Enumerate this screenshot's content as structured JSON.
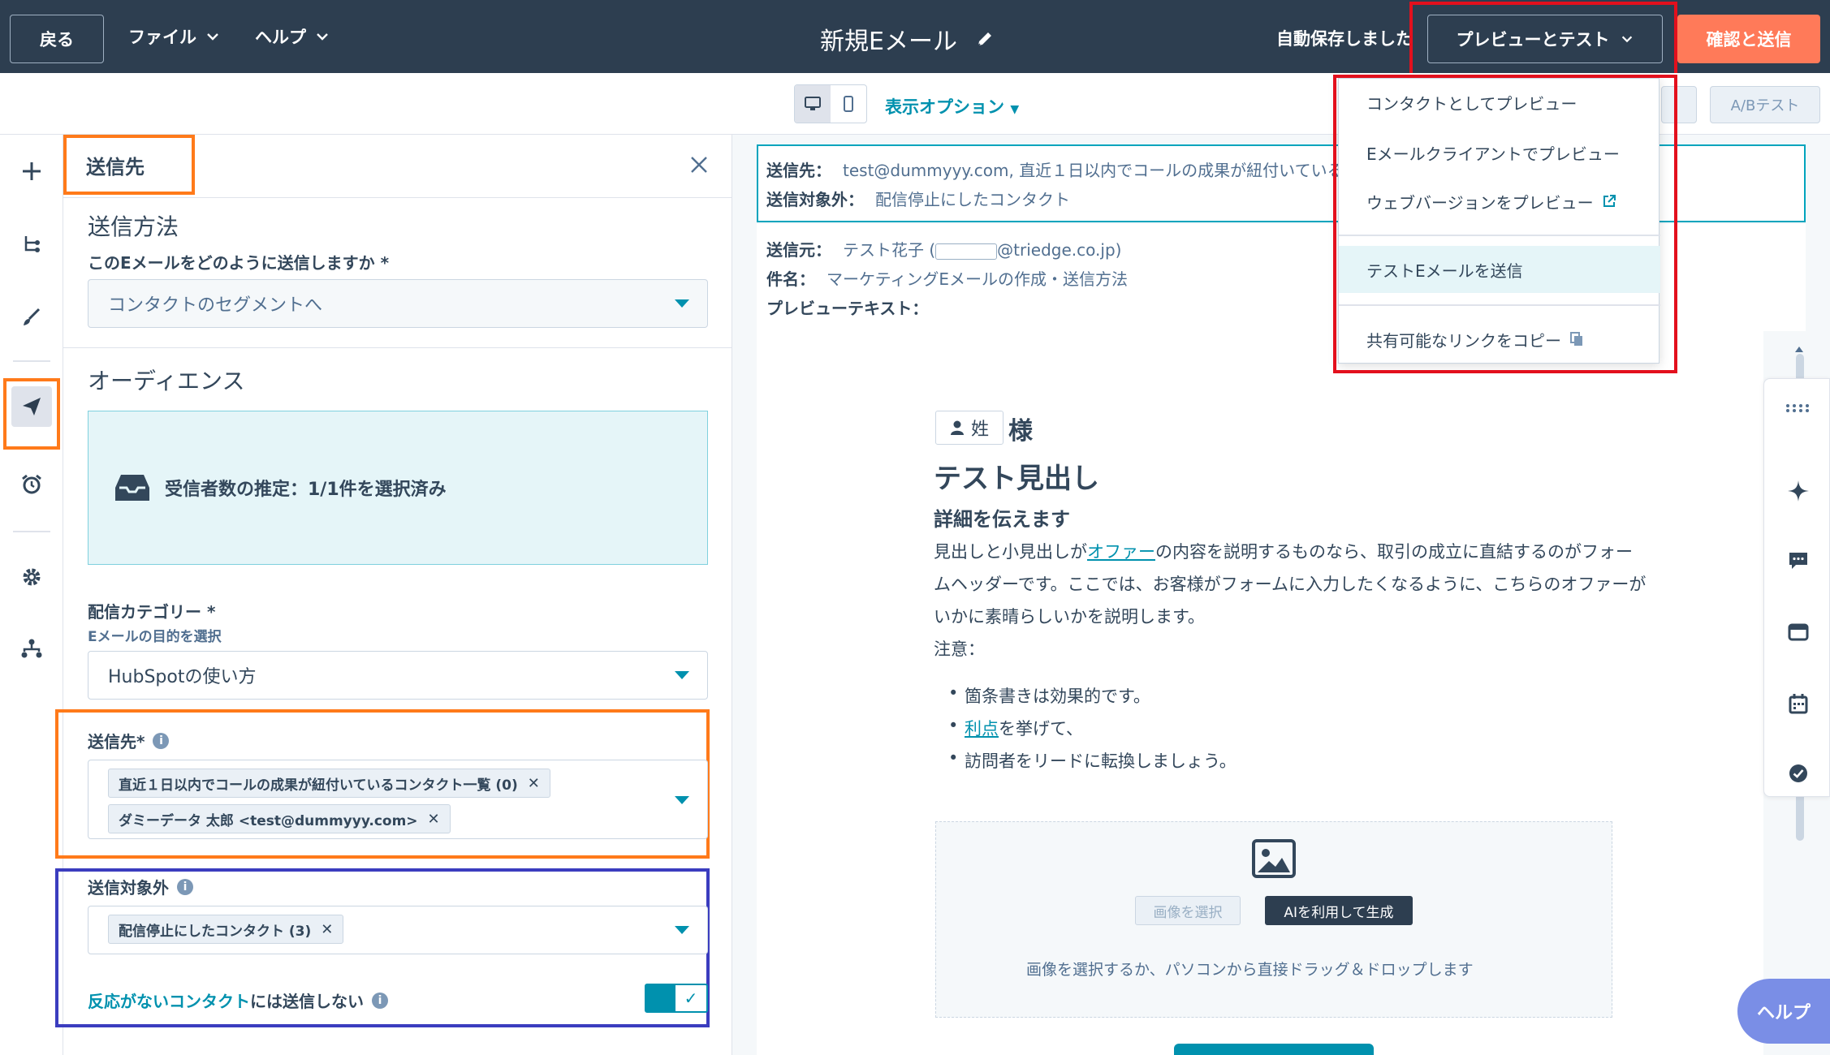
{
  "topbar": {
    "back_label": "戻る",
    "file_menu": "ファイル",
    "help_menu": "ヘルプ",
    "title": "新規Eメール",
    "autosave": "自動保存しました",
    "preview_test_label": "プレビューとテスト",
    "confirm_send_label": "確認と送信"
  },
  "subbar": {
    "display_options": "表示オプション",
    "ab_test": "A/Bテスト"
  },
  "rail": {
    "icons": [
      "plus-icon",
      "tree-icon",
      "brush-icon",
      "send-icon",
      "clock-icon",
      "gear-icon",
      "org-icon"
    ],
    "active": "send-icon"
  },
  "panel": {
    "title": "送信先",
    "send_method": {
      "heading": "送信方法",
      "label": "このEメールをどのように送信しますか *",
      "value": "コンタクトのセグメントへ"
    },
    "audience": {
      "heading": "オーディエンス",
      "estimate": "受信者数の推定：1/1件を選択済み"
    },
    "category": {
      "label": "配信カテゴリー *",
      "sublabel": "Eメールの目的を選択",
      "value": "HubSpotの使い方"
    },
    "send_to": {
      "label": "送信先*",
      "tags": [
        "直近１日以内でコールの成果が紐付いているコンタクト一覧 (0)",
        "ダミーデータ 太郎 <test@dummyyy.com>"
      ]
    },
    "exclude": {
      "label": "送信対象外",
      "tags": [
        "配信停止にしたコンタクト (3)"
      ]
    },
    "unengaged": {
      "link": "反応がないコンタクト",
      "rest": "には送信しない",
      "enabled": true
    }
  },
  "preview": {
    "to_label": "送信先：",
    "to_value": "test@dummyyy.com, 直近１日以内でコールの成果が紐付いている",
    "exclude_label": "送信対象外：",
    "exclude_value": "配信停止にしたコンタクト",
    "from_label": "送信元：",
    "from_value_pre": "テスト花子 (",
    "from_value_post": "@triedge.co.jp)",
    "subject_label": "件名：",
    "subject_value": "マーケティングEメールの作成・送信方法",
    "preview_text_label": "プレビューテキスト：",
    "token": "姓",
    "honorific": "様",
    "heading": "テスト見出し",
    "subheading": "詳細を伝えます",
    "para_1": "見出しと小見出しが",
    "para_link": "オファー",
    "para_2": "の内容を説明するものなら、取引の成立に直結するのがフォームヘッダーです。ここでは、お客様がフォームに入力したくなるように、こちらのオファーがいかに素晴らしいかを説明します。",
    "note": "注意：",
    "bullet_1": "箇条書きは効果的です。",
    "bullet_2_link": "利点",
    "bullet_2_rest": "を挙げて、",
    "bullet_3": "訪問者をリードに転換しましょう。",
    "img_select": "画像を選択",
    "img_ai": "AIを利用して生成",
    "img_hint": "画像を選択するか、パソコンから直接ドラッグ＆ドロップします"
  },
  "dropdown": {
    "items": [
      "コンタクトとしてプレビュー",
      "Eメールクライアントでプレビュー",
      "ウェブバージョンをプレビュー",
      "テストEメールを送信",
      "共有可能なリンクをコピー"
    ],
    "highlighted": "テストEメールを送信"
  },
  "help_label": "ヘルプ",
  "colors": {
    "topbar": "#2d3e50",
    "accent": "#0091ae",
    "cta": "#ff7a59",
    "annotation_orange": "#ff7a1a",
    "annotation_red": "#e3101d",
    "annotation_blue": "#3b3dbf"
  }
}
